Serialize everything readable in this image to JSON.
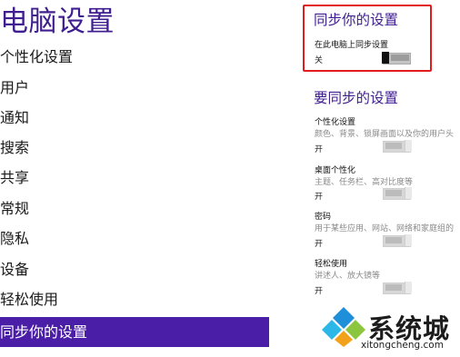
{
  "left": {
    "title": "电脑设置",
    "nav_items": [
      {
        "label": "个性化设置"
      },
      {
        "label": "用户"
      },
      {
        "label": "通知"
      },
      {
        "label": "搜索"
      },
      {
        "label": "共享"
      },
      {
        "label": "常规"
      },
      {
        "label": "隐私"
      },
      {
        "label": "设备"
      },
      {
        "label": "轻松使用"
      },
      {
        "label": "同步你的设置"
      }
    ],
    "active_item": "同步你的设置"
  },
  "right": {
    "sync_section": {
      "title": "同步你的设置",
      "setting_label": "在此电脑上同步设置",
      "state": "关",
      "toggle_on": false
    },
    "items_section": {
      "title": "要同步的设置",
      "items": [
        {
          "label": "个性化设置",
          "desc": "颜色、背景、锁屏画面以及你的用户头",
          "state": "开",
          "toggle_on": true
        },
        {
          "label": "桌面个性化",
          "desc": "主题、任务栏、高对比度等",
          "state": "开",
          "toggle_on": true
        },
        {
          "label": "密码",
          "desc": "用于某些应用、网站、网络和家庭组的",
          "state": "开",
          "toggle_on": true
        },
        {
          "label": "轻松使用",
          "desc": "讲述人、放大镜等",
          "state": "开",
          "toggle_on": true
        }
      ]
    }
  },
  "watermark": {
    "brand": "系统城",
    "domain": "xitongcheng.com"
  },
  "colors": {
    "accent": "#4b1ea8",
    "title": "#3f1e8f",
    "highlight": "#e21d1d"
  }
}
